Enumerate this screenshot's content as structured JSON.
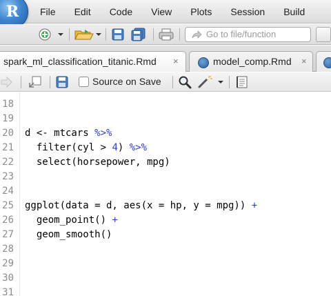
{
  "app": {
    "logo_letter": "R",
    "menu": [
      "File",
      "Edit",
      "Code",
      "View",
      "Plots",
      "Session",
      "Build"
    ]
  },
  "toolbar": {
    "goto_placeholder": "Go to file/function",
    "icons": [
      "new-file-icon",
      "open-folder-icon",
      "save-icon",
      "save-all-icon",
      "print-icon",
      "goto-arrow-icon"
    ]
  },
  "tabs": [
    {
      "label": "spark_ml_classification_titanic.Rmd",
      "close": "×"
    },
    {
      "label": "model_comp.Rmd",
      "close": "×"
    }
  ],
  "editor_toolbar": {
    "source_on_save": "Source on Save",
    "source_on_save_checked": false
  },
  "code": {
    "lines": [
      {
        "n": "18",
        "text": ""
      },
      {
        "n": "19",
        "text": ""
      },
      {
        "n": "20",
        "parts": [
          [
            "d <- mtcars ",
            ""
          ],
          [
            "%>%",
            "op"
          ]
        ]
      },
      {
        "n": "21",
        "parts": [
          [
            "  filter(cyl > ",
            ""
          ],
          [
            "4",
            "num"
          ],
          [
            ") ",
            ""
          ],
          [
            "%>%",
            "op"
          ]
        ]
      },
      {
        "n": "22",
        "parts": [
          [
            "  select(horsepower, mpg)",
            ""
          ]
        ]
      },
      {
        "n": "23",
        "text": ""
      },
      {
        "n": "24",
        "text": ""
      },
      {
        "n": "25",
        "parts": [
          [
            "ggplot(data = d, aes(x = hp, y = mpg)) ",
            ""
          ],
          [
            "+",
            "op"
          ]
        ]
      },
      {
        "n": "26",
        "parts": [
          [
            "  geom_point() ",
            ""
          ],
          [
            "+",
            "op"
          ]
        ]
      },
      {
        "n": "27",
        "parts": [
          [
            "  geom_smooth()",
            ""
          ]
        ]
      },
      {
        "n": "28",
        "text": ""
      },
      {
        "n": "29",
        "text": ""
      },
      {
        "n": "30",
        "text": ""
      },
      {
        "n": "31",
        "text": ""
      }
    ]
  }
}
